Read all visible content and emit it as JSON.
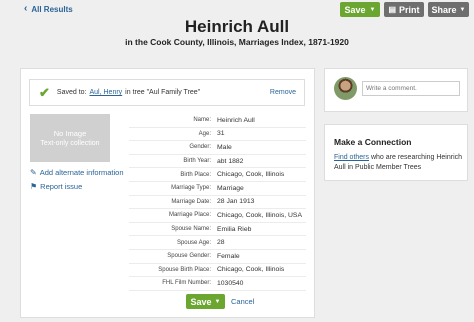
{
  "nav": {
    "back_label": "All Results",
    "back_icon": "chevron-left-icon"
  },
  "toolbar": {
    "save_label": "Save",
    "print_label": "Print",
    "share_label": "Share"
  },
  "record": {
    "name": "Heinrich Aull",
    "subtitle": "in the Cook County, Illinois, Marriages Index, 1871-1920"
  },
  "saved": {
    "prefix": "Saved to:",
    "person_link": "Aul, Henry",
    "tree_text": "in tree \"Aul Family Tree\"",
    "remove_label": "Remove"
  },
  "thumbnail": {
    "line1": "No Image",
    "line2": "Text-only collection"
  },
  "side_links": {
    "add_info": "Add alternate information",
    "report": "Report issue"
  },
  "details": [
    {
      "label": "Name:",
      "value": "Heinrich Aull"
    },
    {
      "label": "Age:",
      "value": "31"
    },
    {
      "label": "Gender:",
      "value": "Male"
    },
    {
      "label": "Birth Year:",
      "value": "abt 1882"
    },
    {
      "label": "Birth Place:",
      "value": "Chicago, Cook, Illinois"
    },
    {
      "label": "Marriage Type:",
      "value": "Marriage"
    },
    {
      "label": "Marriage Date:",
      "value": "28 Jan 1913"
    },
    {
      "label": "Marriage Place:",
      "value": "Chicago, Cook, Illinois, USA"
    },
    {
      "label": "Spouse Name:",
      "value": "Emilia Rieb"
    },
    {
      "label": "Spouse Age:",
      "value": "28"
    },
    {
      "label": "Spouse Gender:",
      "value": "Female"
    },
    {
      "label": "Spouse Birth Place:",
      "value": "Chicago, Cook, Illinois"
    },
    {
      "label": "FHL Film Number:",
      "value": "1030540"
    }
  ],
  "actions": {
    "save_label": "Save",
    "cancel_label": "Cancel"
  },
  "comment": {
    "placeholder": "Write a comment."
  },
  "connection": {
    "title": "Make a Connection",
    "link_text": "Find others",
    "body_text": "who are researching Heinrich Aull in Public Member Trees"
  },
  "colors": {
    "accent_green": "#6aa630",
    "link_blue": "#2a6496",
    "toolbar_gray": "#6e6e6e"
  }
}
